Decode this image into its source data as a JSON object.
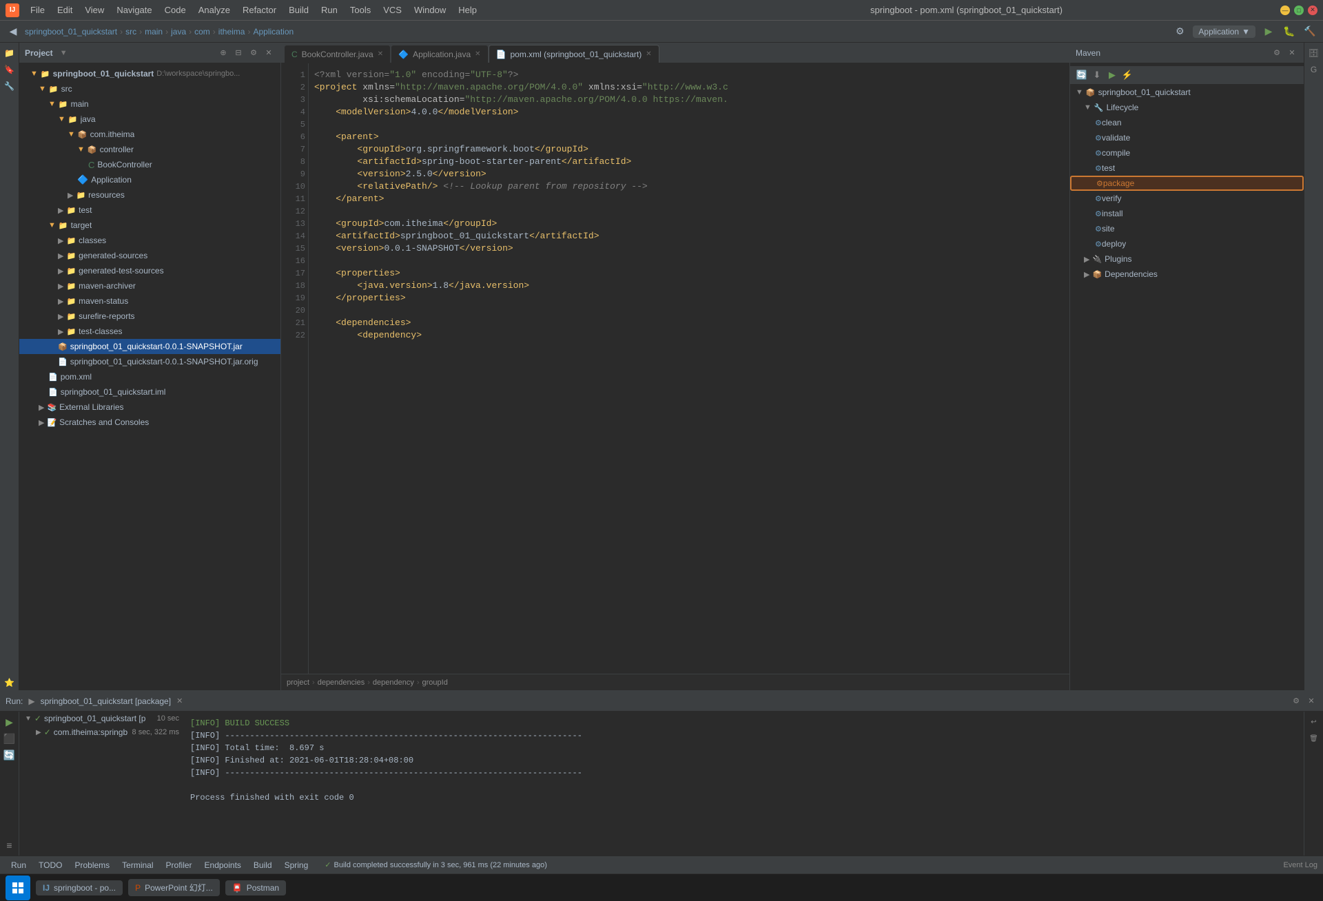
{
  "titlebar": {
    "title": "springboot - pom.xml (springboot_01_quickstart)",
    "min": "—",
    "max": "□",
    "close": "✕"
  },
  "menubar": {
    "items": [
      "File",
      "Edit",
      "View",
      "Navigate",
      "Code",
      "Analyze",
      "Refactor",
      "Build",
      "Run",
      "Tools",
      "VCS",
      "Window",
      "Help"
    ]
  },
  "toolbar": {
    "breadcrumb": [
      "springboot_01_quickstart",
      "src",
      "main",
      "java",
      "com",
      "itheima",
      "Application"
    ],
    "run_config": "Application",
    "run_icon": "▶",
    "build_icon": "🔨"
  },
  "project_panel": {
    "title": "Project",
    "root": "springboot_01_quickstart",
    "root_path": "D:\\workspace\\springbo...",
    "items": [
      {
        "id": "src",
        "label": "src",
        "type": "folder",
        "level": 1,
        "expanded": true
      },
      {
        "id": "main",
        "label": "main",
        "type": "folder",
        "level": 2,
        "expanded": true
      },
      {
        "id": "java",
        "label": "java",
        "type": "folder",
        "level": 3,
        "expanded": true
      },
      {
        "id": "com",
        "label": "com.itheima",
        "type": "folder",
        "level": 4,
        "expanded": true
      },
      {
        "id": "controller",
        "label": "controller",
        "type": "folder",
        "level": 5,
        "expanded": true
      },
      {
        "id": "BookController",
        "label": "BookController",
        "type": "java",
        "level": 6
      },
      {
        "id": "Application",
        "label": "Application",
        "type": "java_app",
        "level": 5
      },
      {
        "id": "resources",
        "label": "resources",
        "type": "folder",
        "level": 4,
        "expanded": false
      },
      {
        "id": "test",
        "label": "test",
        "type": "folder",
        "level": 3,
        "expanded": false
      },
      {
        "id": "target",
        "label": "target",
        "type": "folder",
        "level": 2,
        "expanded": true
      },
      {
        "id": "classes",
        "label": "classes",
        "type": "folder",
        "level": 3,
        "expanded": false
      },
      {
        "id": "generated-sources",
        "label": "generated-sources",
        "type": "folder",
        "level": 3,
        "expanded": false
      },
      {
        "id": "generated-test-sources",
        "label": "generated-test-sources",
        "type": "folder",
        "level": 3,
        "expanded": false
      },
      {
        "id": "maven-archiver",
        "label": "maven-archiver",
        "type": "folder",
        "level": 3,
        "expanded": false
      },
      {
        "id": "maven-status",
        "label": "maven-status",
        "type": "folder",
        "level": 3,
        "expanded": false
      },
      {
        "id": "surefire-reports",
        "label": "surefire-reports",
        "type": "folder",
        "level": 3,
        "expanded": false
      },
      {
        "id": "test-classes",
        "label": "test-classes",
        "type": "folder",
        "level": 3,
        "expanded": false
      },
      {
        "id": "jar",
        "label": "springboot_01_quickstart-0.0.1-SNAPSHOT.jar",
        "type": "jar",
        "level": 3,
        "selected": true
      },
      {
        "id": "jar_orig",
        "label": "springboot_01_quickstart-0.0.1-SNAPSHOT.jar.orig",
        "type": "jar",
        "level": 3
      },
      {
        "id": "pom_xml",
        "label": "pom.xml",
        "type": "xml",
        "level": 2
      },
      {
        "id": "iml",
        "label": "springboot_01_quickstart.iml",
        "type": "iml",
        "level": 2
      },
      {
        "id": "external",
        "label": "External Libraries",
        "type": "folder_ext",
        "level": 1,
        "expanded": false
      },
      {
        "id": "scratches",
        "label": "Scratches and Consoles",
        "type": "folder_scratch",
        "level": 1,
        "expanded": false
      }
    ]
  },
  "editor_tabs": [
    {
      "label": "BookController.java",
      "type": "java",
      "active": false,
      "closeable": true
    },
    {
      "label": "Application.java",
      "type": "java",
      "active": false,
      "closeable": true
    },
    {
      "label": "pom.xml (springboot_01_quickstart)",
      "type": "xml",
      "active": true,
      "closeable": true
    }
  ],
  "code_content": {
    "lines": [
      {
        "num": 1,
        "content": "<?xml version=\"1.0\" encoding=\"UTF-8\"?>"
      },
      {
        "num": 2,
        "content": "<project xmlns=\"http://maven.apache.org/POM/4.0.0\" xmlns:xsi=\"http://www.w3.c"
      },
      {
        "num": 3,
        "content": "         xsi:schemaLocation=\"http://maven.apache.org/POM/4.0.0 https://maven."
      },
      {
        "num": 4,
        "content": "    <modelVersion>4.0.0</modelVersion>"
      },
      {
        "num": 5,
        "content": ""
      },
      {
        "num": 6,
        "content": "    <parent>"
      },
      {
        "num": 7,
        "content": "        <groupId>org.springframework.boot</groupId>"
      },
      {
        "num": 8,
        "content": "        <artifactId>spring-boot-starter-parent</artifactId>"
      },
      {
        "num": 9,
        "content": "        <version>2.5.0</version>"
      },
      {
        "num": 10,
        "content": "        <relativePath/> <!-- Lookup parent from repository -->"
      },
      {
        "num": 11,
        "content": "    </parent>"
      },
      {
        "num": 12,
        "content": ""
      },
      {
        "num": 13,
        "content": "    <groupId>com.itheima</groupId>"
      },
      {
        "num": 14,
        "content": "    <artifactId>springboot_01_quickstart</artifactId>"
      },
      {
        "num": 15,
        "content": "    <version>0.0.1-SNAPSHOT</version>"
      },
      {
        "num": 16,
        "content": ""
      },
      {
        "num": 17,
        "content": "    <properties>"
      },
      {
        "num": 18,
        "content": "        <java.version>1.8</java.version>"
      },
      {
        "num": 19,
        "content": "    </properties>"
      },
      {
        "num": 20,
        "content": ""
      },
      {
        "num": 21,
        "content": "    <dependencies>"
      },
      {
        "num": 22,
        "content": "        <dependency>"
      }
    ],
    "breadcrumb": [
      "project",
      "dependencies",
      "dependency",
      "groupId"
    ]
  },
  "maven_panel": {
    "title": "Maven",
    "root": "springboot_01_quickstart",
    "lifecycle_label": "Lifecycle",
    "lifecycle_items": [
      "clean",
      "validate",
      "compile",
      "test",
      "package",
      "verify",
      "install",
      "site",
      "deploy"
    ],
    "selected_lifecycle": "package",
    "plugins_label": "Plugins",
    "dependencies_label": "Dependencies"
  },
  "bottom_panel": {
    "run_label": "Run:",
    "run_config_label": "springboot_01_quickstart [package]",
    "run_items": [
      {
        "label": "springboot_01_quickstart [p",
        "time": "10 sec"
      },
      {
        "label": "com.itheima:springb",
        "time": "8 sec, 322 ms"
      }
    ],
    "output_lines": [
      {
        "text": "[INFO] BUILD SUCCESS",
        "type": "success"
      },
      {
        "text": "[INFO] ------------------------------------------------------------------------",
        "type": "info"
      },
      {
        "text": "[INFO] Total time:  8.697 s",
        "type": "info"
      },
      {
        "text": "[INFO] Finished at: 2021-06-01T18:28:04+08:00",
        "type": "info"
      },
      {
        "text": "[INFO] ------------------------------------------------------------------------",
        "type": "info"
      },
      {
        "text": "",
        "type": "info"
      },
      {
        "text": "Process finished with exit code 0",
        "type": "info"
      }
    ]
  },
  "status_bar": {
    "tabs": [
      "Run",
      "TODO",
      "Problems",
      "Terminal",
      "Profiler",
      "Endpoints",
      "Build",
      "Spring"
    ],
    "active_tab": "Run",
    "event_log": "Event Log",
    "build_status": "Build completed successfully in 3 sec, 961 ms (22 minutes ago)"
  },
  "taskbar": {
    "items": [
      {
        "label": "springboot - po...",
        "icon": "IJ"
      },
      {
        "label": "PowerPoint 幻灯..."
      },
      {
        "label": "Postman"
      }
    ]
  }
}
